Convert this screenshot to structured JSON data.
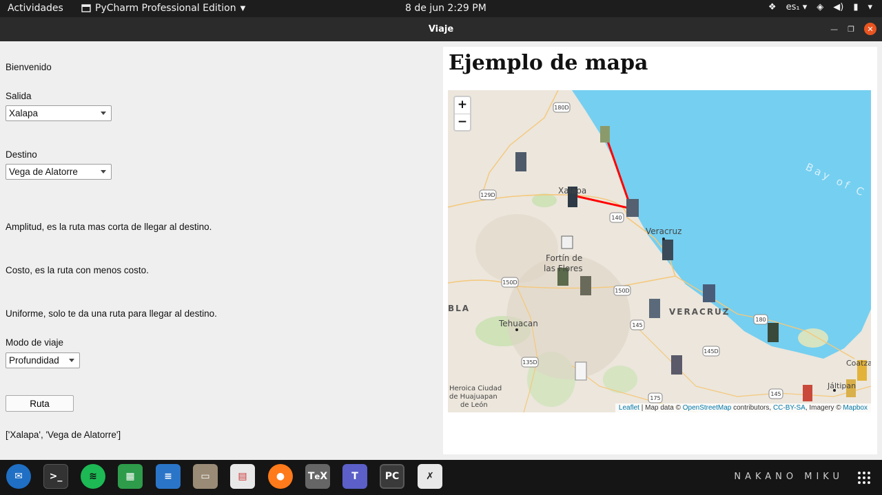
{
  "topbar": {
    "activities": "Actividades",
    "app_name": "PyCharm Professional Edition",
    "clock": "8 de jun  2:29 PM",
    "keyboard": "es₁"
  },
  "window": {
    "title": "Viaje"
  },
  "form": {
    "welcome": "Bienvenido",
    "origin_label": "Salida",
    "origin_value": "Xalapa",
    "dest_label": "Destino",
    "dest_value": "Vega de Alatorre",
    "info_amplitud": "Amplitud, es la ruta mas corta de llegar al destino.",
    "info_costo": "Costo, es la ruta con menos costo.",
    "info_uniforme": "Uniforme, solo te da una ruta para llegar al destino.",
    "mode_label": "Modo de viaje",
    "mode_value": "Profundidad",
    "route_button": "Ruta",
    "result": "['Xalapa', 'Vega de Alatorre']"
  },
  "web": {
    "heading": "Ejemplo de mapa",
    "zoom_in": "+",
    "zoom_out": "−",
    "map_labels": {
      "xalapa": "Xalapa",
      "veracruz_city": "Veracruz",
      "fortin": "Fortín de",
      "fortin2": "las Flores",
      "veracruz_state": "VERACRUZ",
      "tehuacan": "Tehuacan",
      "heroica": "Heroica Ciudad",
      "heroica2": "de Huajuapan",
      "heroica3": "de León",
      "coatzacoalcos": "Coatzac",
      "jaltipan": "Jáltipan",
      "bay": "Bay of C",
      "puebla": "BLA",
      "h180d": "180D",
      "h129d": "129D",
      "h140": "140",
      "h150d_a": "150D",
      "h150d_b": "150D",
      "h145": "145",
      "h145d": "145D",
      "h180": "180",
      "h135d": "135D",
      "h175": "175",
      "h145b": "145"
    },
    "attribution": {
      "leaflet": "Leaflet",
      "map_data": " | Map data © ",
      "osm": "OpenStreetMap",
      "contrib": " contributors, ",
      "ccbysa": "CC-BY-SA",
      "imagery": ", Imagery © ",
      "mapbox": "Mapbox"
    }
  },
  "dock": {
    "brand": "NAKANO MIKU",
    "apps": [
      "thunderbird-icon",
      "terminal-icon",
      "spotify-icon",
      "spreadsheet-icon",
      "writer-icon",
      "files-icon",
      "document-viewer-icon",
      "firefox-icon",
      "texmaker-icon",
      "teams-icon",
      "pycharm-icon",
      "xournal-icon"
    ]
  },
  "colors": {
    "accent": "#e95420",
    "route": "#ff0000",
    "water": "#75cff0"
  }
}
